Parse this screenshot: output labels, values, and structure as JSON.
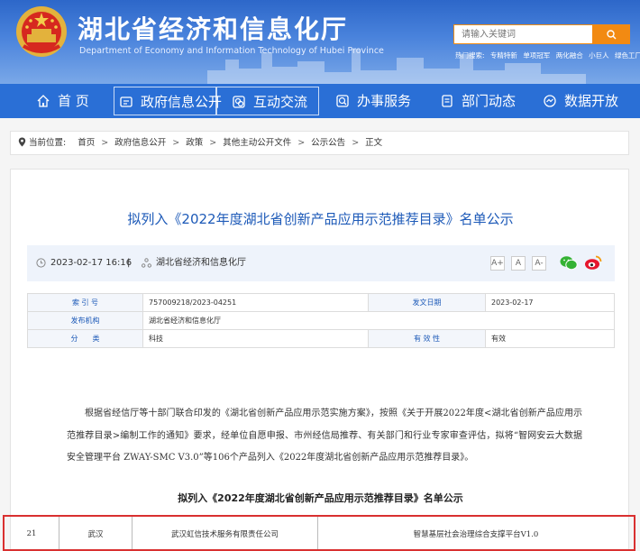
{
  "colors": {
    "header_blue": "#2d67c9",
    "nav_blue": "#2a6fd6",
    "accent_orange": "#f28a12",
    "title_blue": "#1d5ab8",
    "highlight_red": "#d93030"
  },
  "header": {
    "site_name": "湖北省经济和信息化厅",
    "site_name_en": "Department of Economy and Information Technology of Hubei Province",
    "emblem_icon": "national-emblem-icon",
    "search_placeholder": "请输入关键词",
    "search_icon": "search-icon",
    "hot_label": "热门搜索:",
    "hot_words": [
      "专精特新",
      "单项冠军",
      "两化融合",
      "小巨人",
      "绿色工厂"
    ]
  },
  "nav": [
    {
      "label": "首 页",
      "icon": "home-icon"
    },
    {
      "label": "政府信息公开",
      "icon": "document-icon"
    },
    {
      "label": "互动交流",
      "icon": "chat-icon"
    },
    {
      "label": "办事服务",
      "icon": "service-icon"
    },
    {
      "label": "部门动态",
      "icon": "news-icon"
    },
    {
      "label": "数据开放",
      "icon": "data-icon"
    }
  ],
  "breadcrumb": {
    "label": "当前位置:",
    "items": [
      "首页",
      "政府信息公开",
      "政策",
      "其他主动公开文件",
      "公示公告",
      "正文"
    ]
  },
  "article": {
    "title": "拟列入《2022年度湖北省创新产品应用示范推荐目录》名单公示",
    "date": "2023-02-17 16:16",
    "divider": "|",
    "source": "湖北省经济和信息化厅",
    "font_sizes": [
      "A+",
      "A",
      "A-"
    ],
    "share_icons": [
      "wechat-icon",
      "weibo-icon"
    ],
    "info": {
      "index_label": "索 引 号",
      "index_value": "757009218/2023-04251",
      "issue_date_label": "发文日期",
      "issue_date_value": "2023-02-17",
      "org_label": "发布机构",
      "org_value": "湖北省经济和信息化厅",
      "category_label": "分　　类",
      "category_value": "科技",
      "validity_label": "有 效 性",
      "validity_value": "有效"
    },
    "body": "根据省经信厅等十部门联合印发的《湖北省创新产品应用示范实施方案》，按照《关于开展2022年度<湖北省创新产品应用示范推荐目录>编制工作的通知》要求，经单位自愿申报、市州经信局推荐、有关部门和行业专家审查评估，拟将“智网安云大数据安全管理平台 ZWAY-SMC V3.0”等106个产品列入《2022年度湖北省创新产品应用示范推荐目录》。",
    "list_title": "拟列入《2022年度湖北省创新产品应用示范推荐目录》名单公示",
    "row": {
      "no": "21",
      "city": "武汉",
      "company": "武汉虹信技术服务有限责任公司",
      "product": "智慧基层社会治理综合支撑平台V1.0"
    }
  }
}
